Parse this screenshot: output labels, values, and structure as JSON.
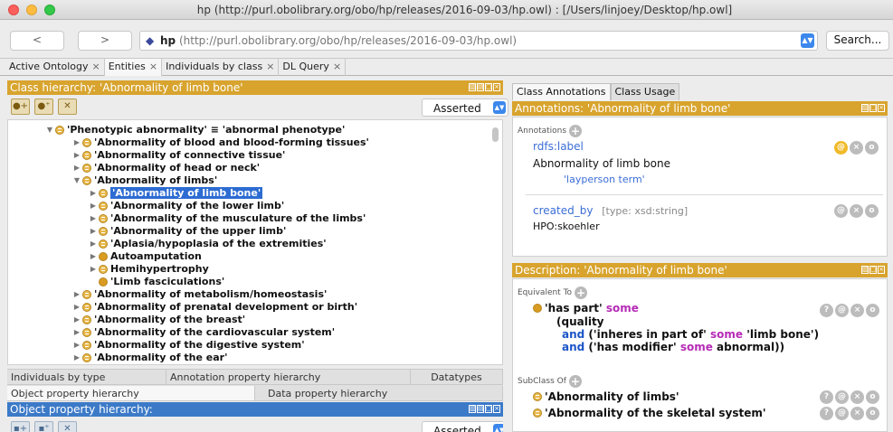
{
  "window": {
    "title": "hp (http://purl.obolibrary.org/obo/hp/releases/2016-09-03/hp.owl)  : [/Users/linjoey/Desktop/hp.owl]"
  },
  "nav": {
    "back": "<",
    "forward": ">",
    "ontology_name": "hp",
    "ontology_iri": "(http://purl.obolibrary.org/obo/hp/releases/2016-09-03/hp.owl)",
    "search_label": "Search..."
  },
  "tabs": [
    {
      "label": "Active Ontology",
      "close": "×"
    },
    {
      "label": "Entities",
      "close": "×"
    },
    {
      "label": "Individuals by class",
      "close": "×"
    },
    {
      "label": "DL Query",
      "close": "×"
    }
  ],
  "class_hierarchy": {
    "header": "Class hierarchy: 'Abnormality of limb bone'",
    "mode": "Asserted",
    "rows": [
      {
        "label": "'Phenotypic abnormality' ≡ 'abnormal phenotype'",
        "twisty": "▼",
        "icon": "eq"
      },
      {
        "label": "'Abnormality of blood and blood-forming tissues'",
        "twisty": "▶",
        "icon": "eq"
      },
      {
        "label": "'Abnormality of connective tissue'",
        "twisty": "▶",
        "icon": "eq"
      },
      {
        "label": "'Abnormality of head or neck'",
        "twisty": "▶",
        "icon": "eq"
      },
      {
        "label": "'Abnormality of limbs'",
        "twisty": "▼",
        "icon": "eq"
      },
      {
        "label": "'Abnormality of limb bone'",
        "twisty": "▶",
        "icon": "eq",
        "selected": true
      },
      {
        "label": "'Abnormality of the lower limb'",
        "twisty": "▶",
        "icon": "eq"
      },
      {
        "label": "'Abnormality of the musculature of the limbs'",
        "twisty": "▶",
        "icon": "eq"
      },
      {
        "label": "'Abnormality of the upper limb'",
        "twisty": "▶",
        "icon": "eq"
      },
      {
        "label": "'Aplasia/hypoplasia of the extremities'",
        "twisty": "▶",
        "icon": "eq"
      },
      {
        "label": "Autoamputation",
        "twisty": "▶",
        "icon": "plain"
      },
      {
        "label": "Hemihypertrophy",
        "twisty": "▶",
        "icon": "eq"
      },
      {
        "label": "'Limb fasciculations'",
        "twisty": "",
        "icon": "plain"
      },
      {
        "label": "'Abnormality of metabolism/homeostasis'",
        "twisty": "▶",
        "icon": "eq"
      },
      {
        "label": "'Abnormality of prenatal development or birth'",
        "twisty": "▶",
        "icon": "eq"
      },
      {
        "label": "'Abnormality of the breast'",
        "twisty": "▶",
        "icon": "eq"
      },
      {
        "label": "'Abnormality of the cardiovascular system'",
        "twisty": "▶",
        "icon": "eq"
      },
      {
        "label": "'Abnormality of the digestive system'",
        "twisty": "▶",
        "icon": "eq"
      },
      {
        "label": "'Abnormality of the ear'",
        "twisty": "▶",
        "icon": "eq"
      }
    ]
  },
  "bottom_tabs": {
    "row1": [
      "Individuals by type",
      "Annotation property hierarchy",
      "Datatypes"
    ],
    "row2": [
      "Object property hierarchy",
      "Data property hierarchy"
    ]
  },
  "object_property": {
    "header": "Object property hierarchy:",
    "mode": "Asserted"
  },
  "right_tabs": [
    "Class Annotations",
    "Class Usage"
  ],
  "annotations": {
    "header": "Annotations: 'Abnormality of limb bone'",
    "section_label": "Annotations",
    "label_prop": "rdfs:label",
    "label_value": "Abnormality of limb bone",
    "label_annotation": "'layperson term'",
    "created_prop": "created_by",
    "created_type": "[type: xsd:string]",
    "created_value": "HPO:skoehler"
  },
  "description": {
    "header": "Description: 'Abnormality of limb bone'",
    "equivalent_label": "Equivalent To",
    "eq_line1_a": "'has part'",
    "eq_line1_b": "some",
    "eq_line2": "(quality",
    "eq_line3_and": "and",
    "eq_line3_a": "('inheres in part of'",
    "eq_line3_some": "some",
    "eq_line3_b": "'limb bone')",
    "eq_line4_and": "and",
    "eq_line4_a": "('has modifier'",
    "eq_line4_some": "some",
    "eq_line4_b": "abnormal))",
    "subclass_label": "SubClass Of",
    "subclasses": [
      "'Abnormality of limbs'",
      "'Abnormality of the skeletal system'"
    ]
  },
  "controls": {
    "add": "+",
    "at": "@",
    "delete": "×",
    "edit": "o",
    "explain": "?"
  }
}
